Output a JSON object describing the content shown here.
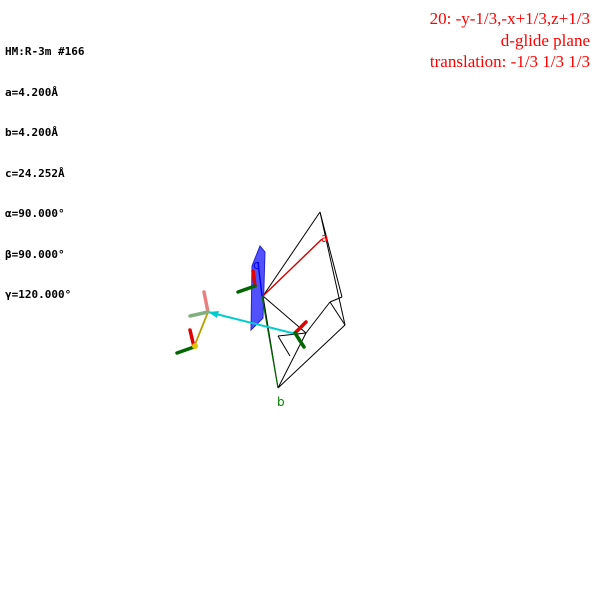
{
  "cell": {
    "space_group": "HM:R-3m #166",
    "a": "a=4.200Å",
    "b": "b=4.200Å",
    "c": "c=24.252Å",
    "alpha": "α=90.000°",
    "beta": "β=90.000°",
    "gamma": "γ=120.000°"
  },
  "symop": {
    "operation": "20: -y-1/3,-x+1/3,z+1/3",
    "element": "d-glide plane",
    "translation": "translation: -1/3 1/3 1/3",
    "color": "#ff0000"
  },
  "axes": {
    "a_label": "a",
    "a_color": "#ff0000",
    "b_label": "b",
    "b_color": "#008000",
    "c_label": "c",
    "c_color": "#0000ff"
  },
  "colors": {
    "glide_plane": "#3333ff",
    "translation_vector": "#00cccc",
    "origin_connector": "#b8a000",
    "axis_red": "#e00000",
    "axis_green": "#006600"
  }
}
